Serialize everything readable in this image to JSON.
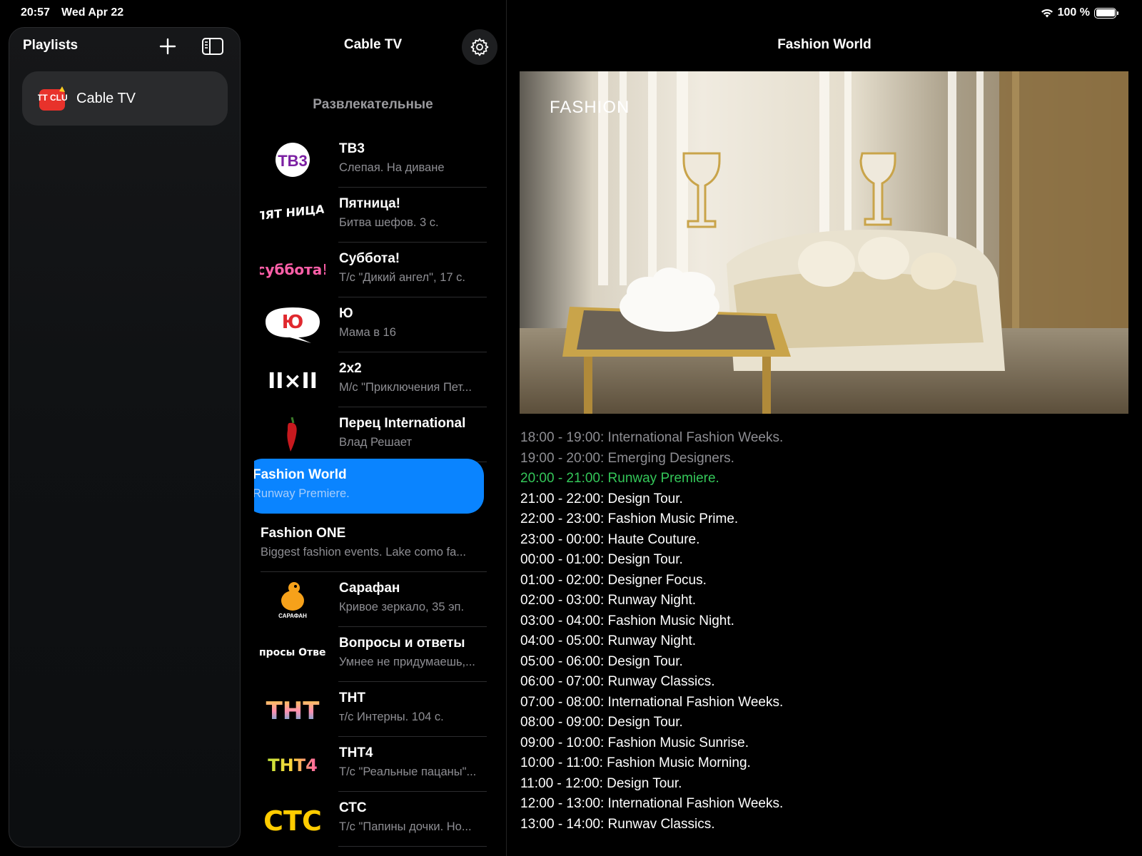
{
  "status_bar": {
    "time": "20:57",
    "date": "Wed Apr 22",
    "battery": "100 %",
    "battery_level": 1.0
  },
  "sidebar": {
    "title": "Playlists",
    "add_icon": "plus-icon",
    "toggle_icon": "sidebar-toggle-icon",
    "playlists": [
      {
        "label": "Cable TV",
        "logo": "OTT CLUB"
      }
    ]
  },
  "channel_list": {
    "title": "Cable TV",
    "settings_icon": "gear-icon",
    "group": "Развлекательные",
    "channels": [
      {
        "name": "ТВ3",
        "program": "Слепая. На диване",
        "logo": "tv3"
      },
      {
        "name": "Пятница!",
        "program": "Битва шефов. 3 с.",
        "logo": "friday"
      },
      {
        "name": "Суббота!",
        "program": "Т/с \"Дикий ангел\", 17 с.",
        "logo": "subbota"
      },
      {
        "name": "Ю",
        "program": "Мама в 16",
        "logo": "yu"
      },
      {
        "name": "2x2",
        "program": "М/с \"Приключения Пет...",
        "logo": "2x2"
      },
      {
        "name": "Перец International",
        "program": "Влад Решает",
        "logo": "perets"
      },
      {
        "name": "Fashion World",
        "program": "Runway Premiere.",
        "logo": "",
        "selected": true
      },
      {
        "name": "Fashion ONE",
        "program": "Biggest fashion events. Lake como fa...",
        "logo": ""
      },
      {
        "name": "Сарафан",
        "program": "Кривое зеркало, 35 эп.",
        "logo": "sarafan"
      },
      {
        "name": "Вопросы и ответы",
        "program": "Умнее не придумаешь,...",
        "logo": "voprosy"
      },
      {
        "name": "ТНТ",
        "program": "т/с Интерны. 104 с.",
        "logo": "tnt"
      },
      {
        "name": "ТНТ4",
        "program": "Т/с \"Реальные пацаны\"...",
        "logo": "tnt4"
      },
      {
        "name": "СТС",
        "program": "Т/с \"Папины дочки. Но...",
        "logo": "sts"
      }
    ],
    "logo_text": {
      "tv3": "ТВ3",
      "friday": "ПЯТ НИЦА!",
      "subbota": "суббота!",
      "yu": "Ю",
      "2x2": "II×II",
      "sarafan": "САРАФАН",
      "voprosy": "Вопросы Ответы",
      "tnt": "ТНТ",
      "tnt4": "ТНТ4",
      "sts": "СТС"
    }
  },
  "player": {
    "title": "Fashion World",
    "watermark": "FASHION",
    "schedule": [
      {
        "text": "18:00 - 19:00: International Fashion Weeks.",
        "state": "past"
      },
      {
        "text": "19:00 - 20:00: Emerging Designers.",
        "state": "past"
      },
      {
        "text": "20:00 - 21:00: Runway Premiere.",
        "state": "current"
      },
      {
        "text": "21:00 - 22:00: Design Tour.",
        "state": "future"
      },
      {
        "text": "22:00 - 23:00: Fashion Music Prime.",
        "state": "future"
      },
      {
        "text": "23:00 - 00:00: Haute Couture.",
        "state": "future"
      },
      {
        "text": "00:00 - 01:00: Design Tour.",
        "state": "future"
      },
      {
        "text": "01:00 - 02:00: Designer Focus.",
        "state": "future"
      },
      {
        "text": "02:00 - 03:00: Runway Night.",
        "state": "future"
      },
      {
        "text": "03:00 - 04:00: Fashion Music Night.",
        "state": "future"
      },
      {
        "text": "04:00 - 05:00: Runway Night.",
        "state": "future"
      },
      {
        "text": "05:00 - 06:00: Design Tour.",
        "state": "future"
      },
      {
        "text": "06:00 - 07:00: Runway Classics.",
        "state": "future"
      },
      {
        "text": "07:00 - 08:00: International Fashion Weeks.",
        "state": "future"
      },
      {
        "text": "08:00 - 09:00: Design Tour.",
        "state": "future"
      },
      {
        "text": "09:00 - 10:00: Fashion Music Sunrise.",
        "state": "future"
      },
      {
        "text": "10:00 - 11:00: Fashion Music Morning.",
        "state": "future"
      },
      {
        "text": "11:00 - 12:00: Design Tour.",
        "state": "future"
      },
      {
        "text": "12:00 - 13:00: International Fashion Weeks.",
        "state": "future"
      },
      {
        "text": "13:00 - 14:00: Runwav Classics.",
        "state": "future"
      }
    ]
  },
  "colors": {
    "accent": "#0a84ff",
    "current_program": "#34c759",
    "muted": "#8e8e93"
  }
}
